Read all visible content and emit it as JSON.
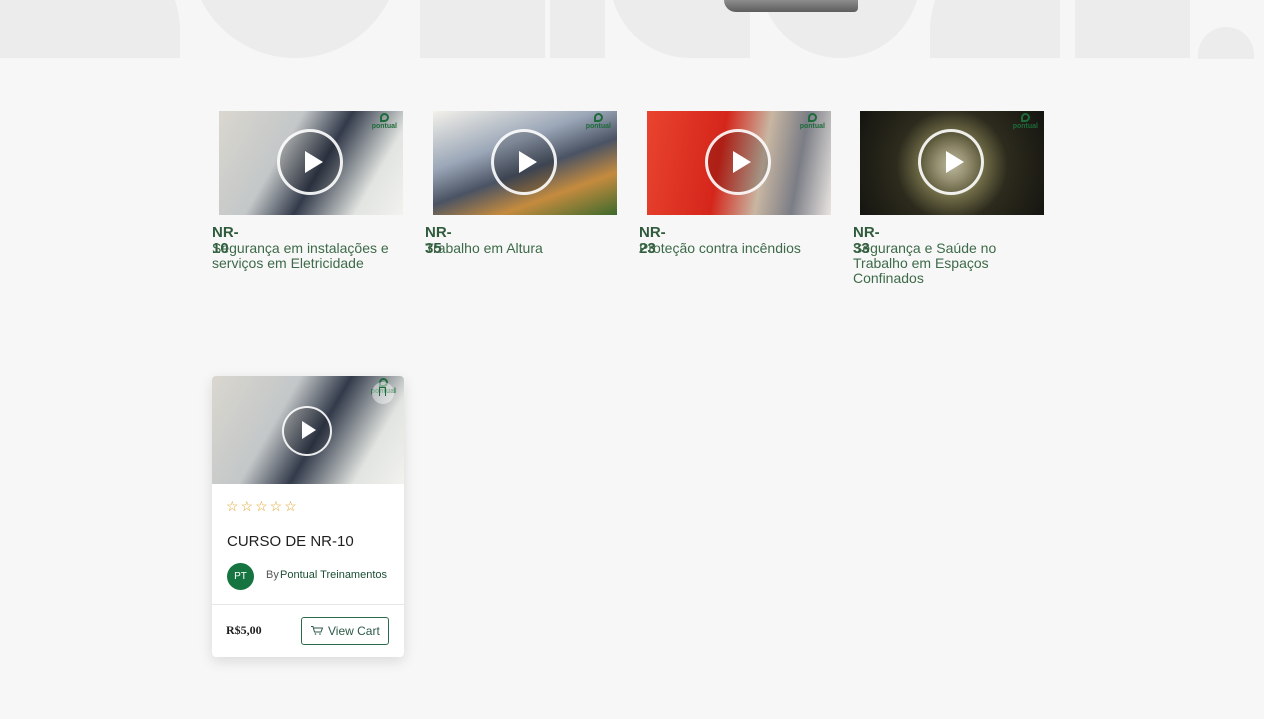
{
  "courses": [
    {
      "code": "NR-10",
      "description": "Segurança em instalações e serviços em Eletricidade",
      "logo": "pontual"
    },
    {
      "code": "NR-35",
      "description": "Trabalho em Altura",
      "logo": "pontual"
    },
    {
      "code": "NR-23",
      "description": "Proteção contra incêndios",
      "logo": "pontual"
    },
    {
      "code": "NR-33",
      "description": "Segurança e Saúde no Trabalho em Espaços Confinados",
      "logo": "pontual"
    }
  ],
  "product": {
    "title": "CURSO DE NR-10",
    "rating_stars": "☆☆☆☆☆",
    "author_initials": "PT",
    "author_prefix": "By",
    "author_name": "Pontual Treinamentos",
    "price": "R$5,00",
    "cart_label": "View Cart",
    "logo": "pontual"
  },
  "colors": {
    "brand_green": "#15743f",
    "text_green": "#3d6a48",
    "star": "#e0a22c"
  }
}
